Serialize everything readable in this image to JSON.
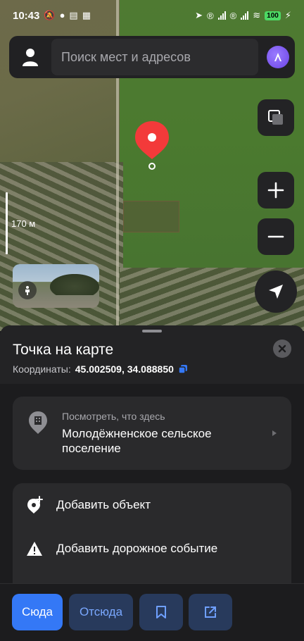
{
  "status_bar": {
    "time": "10:43",
    "battery": "100"
  },
  "search": {
    "placeholder": "Поиск мест и адресов"
  },
  "map": {
    "scale_label": "170 м"
  },
  "place": {
    "title": "Точка на карте",
    "coords_label": "Координаты:",
    "coords_value": "45.002509, 34.088850"
  },
  "whats_here": {
    "subtitle": "Посмотреть, что здесь",
    "name": "Молодёжненское сельское поселение"
  },
  "actions": [
    {
      "label": "Добавить объект",
      "icon": "add-place-icon"
    },
    {
      "label": "Добавить дорожное событие",
      "icon": "warning-icon"
    }
  ],
  "bottom_bar": {
    "to_label": "Сюда",
    "from_label": "Отсюда",
    "bookmark_icon": "bookmark-icon",
    "share_icon": "share-icon"
  },
  "colors": {
    "accent": "#3478f6",
    "pin": "#f33a3a",
    "alice": "#7b5cff"
  }
}
